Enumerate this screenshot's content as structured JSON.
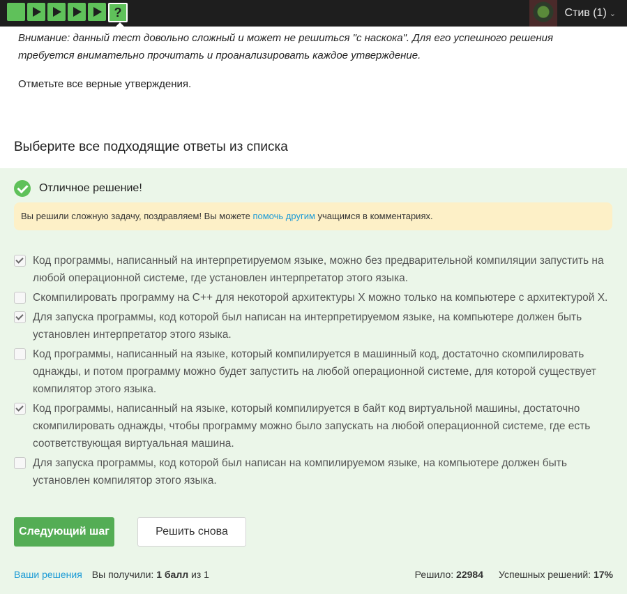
{
  "user": {
    "name": "Стив (1)"
  },
  "steps": [
    {
      "type": "solved"
    },
    {
      "type": "video"
    },
    {
      "type": "video"
    },
    {
      "type": "video"
    },
    {
      "type": "video"
    },
    {
      "type": "question",
      "symbol": "?"
    }
  ],
  "task": {
    "warning": "Внимание: данный тест довольно сложный и может не решиться \"с наскока\". Для его успешного решения требуется внимательно прочитать и проанализировать каждое утверждение.",
    "instruction": "Отметьте все верные утверждения.",
    "section_title": "Выберите все подходящие ответы из списка"
  },
  "result": {
    "message": "Отличное решение!",
    "notice_before": "Вы решили сложную задачу, поздравляем! Вы можете ",
    "notice_link": "помочь другим",
    "notice_after": " учащимся в комментариях."
  },
  "options": [
    {
      "text": "Код программы, написанный на интерпретируемом языке, можно без предварительной компиляции запустить на любой операционной системе, где установлен интерпретатор этого языка.",
      "checked": true
    },
    {
      "text": "Скомпилировать программу на C++ для некоторой архитектуры X можно только на компьютере с архитектурой X.",
      "checked": false
    },
    {
      "text": "Для запуска программы, код которой был написан на интерпретируемом языке, на компьютере должен быть установлен интерпретатор этого языка.",
      "checked": true
    },
    {
      "text": "Код программы, написанный на языке, который компилируется в машинный код, достаточно скомпилировать однажды, и потом программу можно будет запустить на любой операционной системе, для которой существует компилятор этого языка.",
      "checked": false
    },
    {
      "text": "Код программы, написанный на языке, который компилируется в байт код виртуальной машины, достаточно скомпилировать однажды, чтобы программу можно было запускать на любой операционной системе, где есть соответствующая виртуальная машина.",
      "checked": true
    },
    {
      "text": "Для запуска программы, код которой был написан на компилируемом языке, на компьютере должен быть установлен компилятор этого языка.",
      "checked": false
    }
  ],
  "buttons": {
    "next": "Следующий шаг",
    "retry": "Решить снова"
  },
  "footer": {
    "solutions_link": "Ваши решения",
    "received_label": "Вы получили: ",
    "received_value": "1 балл",
    "received_suffix": " из 1",
    "solved_label": "Решило: ",
    "solved_value": "22984",
    "success_label": "Успешных решений: ",
    "success_value": "17%"
  }
}
